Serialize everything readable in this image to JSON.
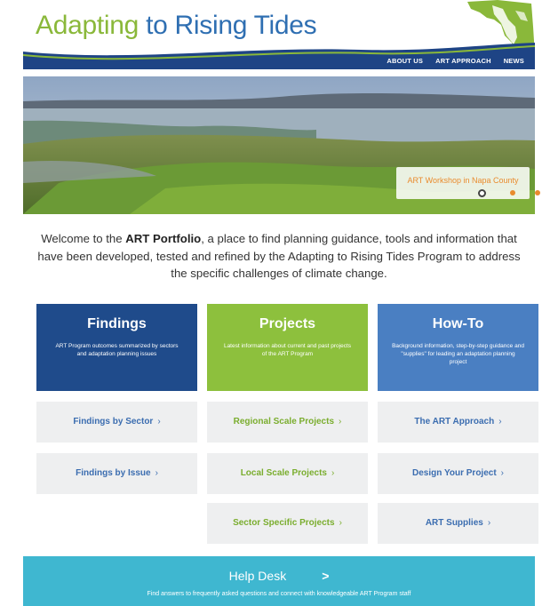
{
  "header": {
    "logo_word_1": "Adapting",
    "logo_word_2": "to Rising Tides",
    "nav": [
      "ABOUT US",
      "ART APPROACH",
      "NEWS"
    ]
  },
  "hero": {
    "caption": "ART Workshop in Napa County",
    "slide_count": 3,
    "active_slide": 1
  },
  "intro": {
    "before": "Welcome to the ",
    "bold": "ART Portfolio",
    "after": ", a place to find planning guidance, tools and information that have been developed, tested and refined by the Adapting to Rising Tides Program to address the specific challenges of climate change."
  },
  "cards": {
    "findings": {
      "title": "Findings",
      "desc": "ART Program outcomes summarized by sectors and adaptation planning issues"
    },
    "projects": {
      "title": "Projects",
      "desc": "Latest information about current and past projects of the ART Program"
    },
    "howto": {
      "title": "How-To",
      "desc": "Background information, step-by-step guidance and \"supplies\" for leading an adaptation planning project"
    }
  },
  "links": {
    "findings": [
      "Findings by Sector",
      "Findings by Issue"
    ],
    "projects": [
      "Regional Scale Projects",
      "Local Scale Projects",
      "Sector Specific Projects"
    ],
    "howto": [
      "The ART Approach",
      "Design Your Project",
      "ART Supplies"
    ]
  },
  "help_desk": {
    "title": "Help Desk",
    "arrow": ">",
    "desc": "Find answers to frequently asked questions and connect with knowledgeable ART Program staff"
  },
  "chevron": "›",
  "colors": {
    "navy": "#1f4b8b",
    "green": "#8dc03d",
    "blue": "#4a7fc2",
    "teal": "#3fb7d0",
    "orange": "#e98b2e"
  }
}
